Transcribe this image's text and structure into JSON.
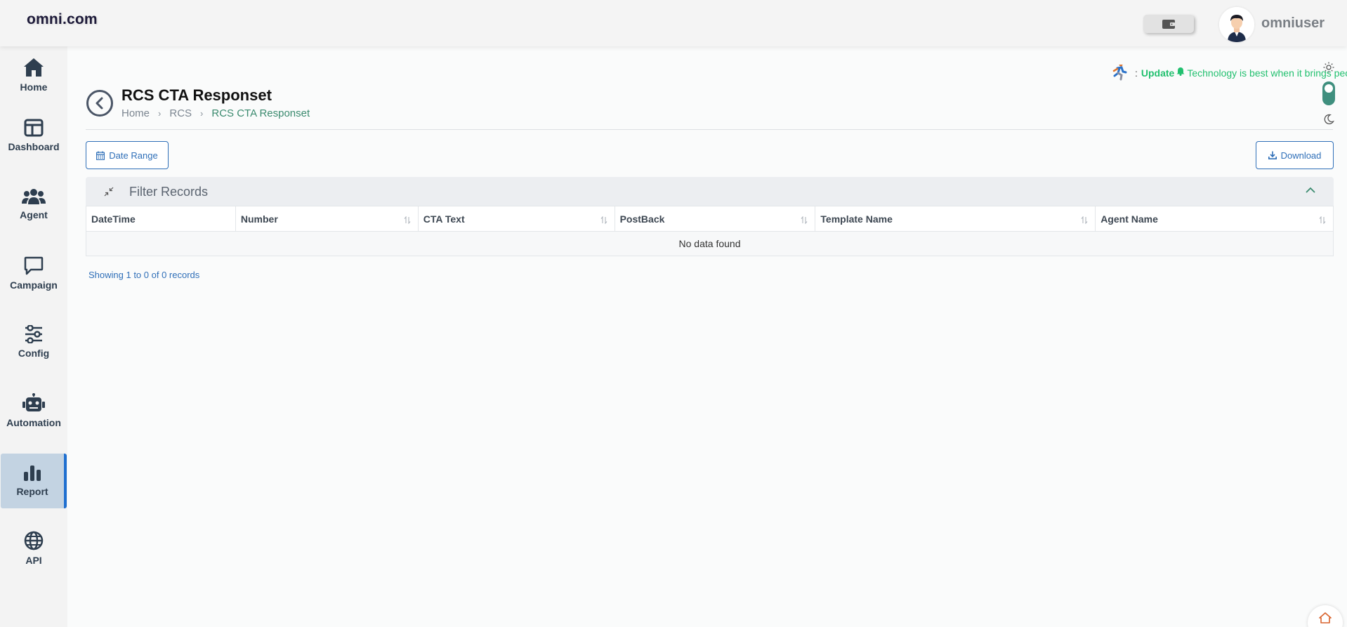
{
  "app": {
    "brand": "omni.com",
    "username": "omniuser"
  },
  "sidebar": {
    "items": [
      {
        "label": "Home",
        "icon": "home-icon"
      },
      {
        "label": "Dashboard",
        "icon": "dashboard-icon"
      },
      {
        "label": "Agent",
        "icon": "agent-icon"
      },
      {
        "label": "Campaign",
        "icon": "campaign-icon"
      },
      {
        "label": "Config",
        "icon": "config-icon"
      },
      {
        "label": "Automation",
        "icon": "automation-icon"
      },
      {
        "label": "Report",
        "icon": "report-icon",
        "active": true
      },
      {
        "label": "API",
        "icon": "api-icon"
      }
    ]
  },
  "ticker": {
    "prefix": ":",
    "update": "Update",
    "message": "Technology is best when it brings people together."
  },
  "page": {
    "title": "RCS CTA Responset",
    "breadcrumb": [
      "Home",
      "RCS",
      "RCS CTA Responset"
    ]
  },
  "toolbar": {
    "date_range": "Date Range",
    "download": "Download"
  },
  "filter": {
    "title": "Filter Records"
  },
  "table": {
    "columns": [
      "DateTime",
      "Number",
      "CTA Text",
      "PostBack",
      "Template Name",
      "Agent Name"
    ],
    "empty_text": "No data found"
  },
  "footer": {
    "showing": "Showing 1 to 0 of 0 records"
  },
  "colors": {
    "accent": "#2f6fb8",
    "ticker": "#22c06f",
    "active_nav": "#c3d3e2",
    "breadcrumb_current": "#3a8a6e"
  }
}
